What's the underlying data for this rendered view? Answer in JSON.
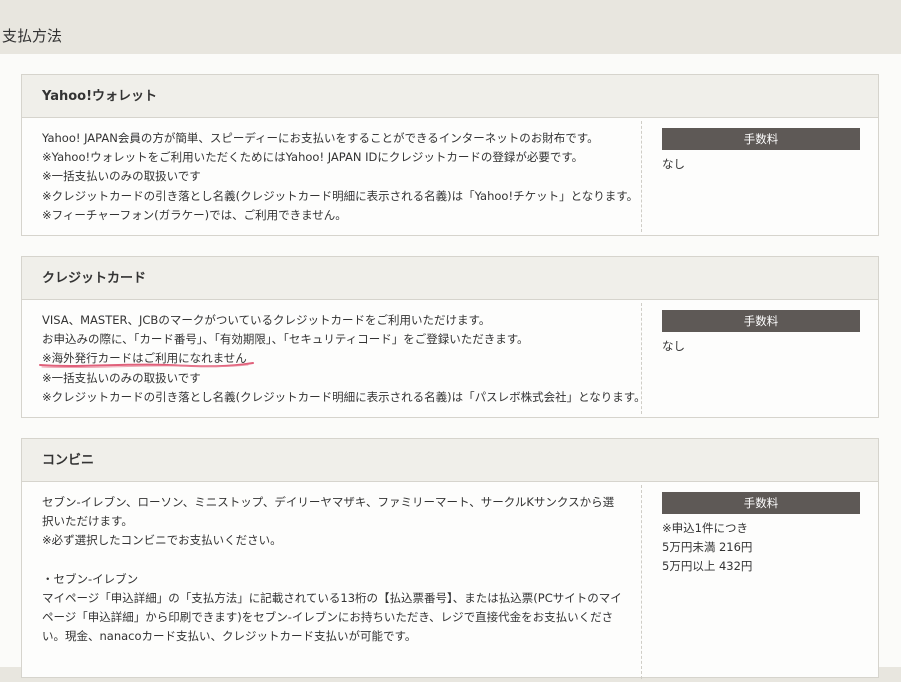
{
  "page": {
    "title": "支払方法"
  },
  "methods": [
    {
      "name": "Yahoo!ウォレット",
      "description": [
        "Yahoo! JAPAN会員の方が簡単、スピーディーにお支払いをすることができるインターネットのお財布です。",
        "※Yahoo!ウォレットをご利用いただくためにはYahoo! JAPAN IDにクレジットカードの登録が必要です。",
        "※一括支払いのみの取扱いです",
        "※クレジットカードの引き落とし名義(クレジットカード明細に表示される名義)は「Yahoo!チケット」となります。",
        "※フィーチャーフォン(ガラケー)では、ご利用できません。"
      ],
      "fee_label": "手数料",
      "fee_values": [
        "なし"
      ]
    },
    {
      "name": "クレジットカード",
      "description": [
        "VISA、MASTER、JCBのマークがついているクレジットカードをご利用いただけます。",
        "お申込みの際に、「カード番号」、「有効期限」、「セキュリティコード」をご登録いただきます。",
        "※海外発行カードはご利用になれません",
        "※一括支払いのみの取扱いです",
        "※クレジットカードの引き落とし名義(クレジットカード明細に表示される名義)は「パスレボ株式会社」となります。"
      ],
      "fee_label": "手数料",
      "fee_values": [
        "なし"
      ],
      "annotation_color": "#e0607a"
    },
    {
      "name": "コンビニ",
      "description": [
        "セブン-イレブン、ローソン、ミニストップ、デイリーヤマザキ、ファミリーマート、サークルKサンクスから選択いただけます。",
        "※必ず選択したコンビニでお支払いください。",
        "",
        "・セブン-イレブン",
        "マイページ「申込詳細」の「支払方法」に記載されている13桁の【払込票番号】、または払込票(PCサイトのマイページ「申込詳細」から印刷できます)をセブン-イレブンにお持ちいただき、レジで直接代金をお支払いください。現金、nanacoカード支払い、クレジットカード支払いが可能です。"
      ],
      "fee_label": "手数料",
      "fee_values": [
        "※申込1件につき",
        "5万円未満 216円",
        "5万円以上 432円"
      ]
    }
  ],
  "colors": {
    "page_bg": "#e8e6df",
    "panel_bg": "#fbfbf9",
    "header_bg": "#f0efea",
    "border": "#d6d4cd",
    "fee_label_bg": "#5e5956"
  }
}
